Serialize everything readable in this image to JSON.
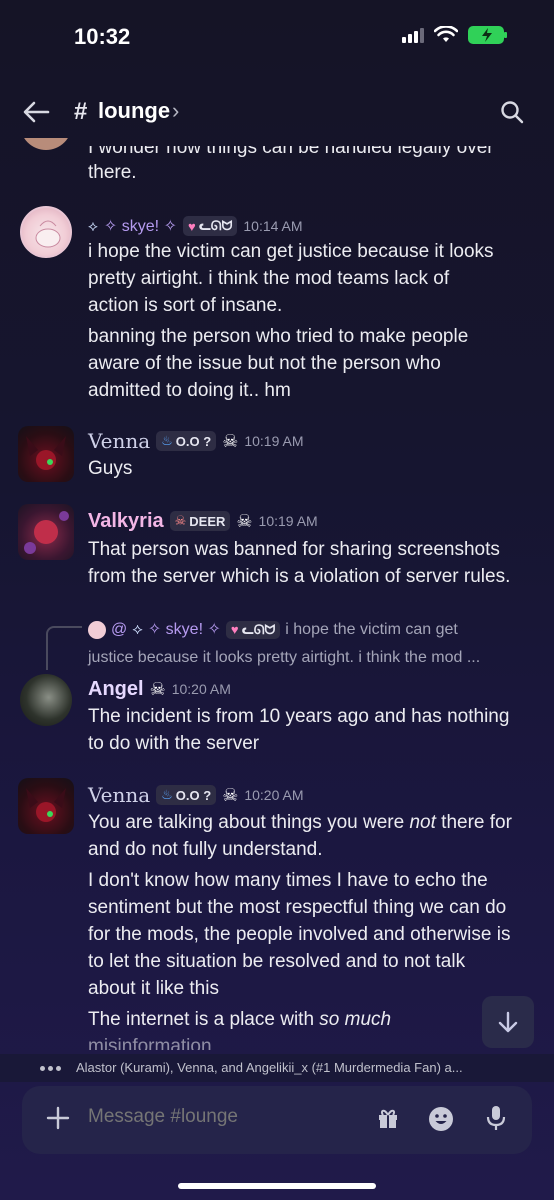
{
  "status": {
    "time": "10:32"
  },
  "header": {
    "hash": "#",
    "channel": "lounge",
    "chevron": "›"
  },
  "messages": {
    "partial_top": {
      "clipped": "I wonder how things can be handled legally over",
      "line2": "there."
    },
    "skye": {
      "name": "✧ skye! ✧",
      "tag": "ᓚᘏᗢ",
      "time": "10:14 AM",
      "lines": [
        "i hope the victim can get justice because it looks",
        "pretty airtight. i think the mod teams lack of",
        "action is sort of insane.",
        "banning the person who tried to make people",
        "aware of the issue but not the person who",
        "admitted to doing it.. hm"
      ]
    },
    "venna1": {
      "name": "Venna",
      "tag": "O.O ?",
      "time": "10:19 AM",
      "lines": [
        "Guys"
      ]
    },
    "valkyria": {
      "name": "Valkyria",
      "tag": "DEER",
      "time": "10:19 AM",
      "lines": [
        "That person was banned for sharing screenshots",
        "from the server which is a violation of server rules."
      ]
    },
    "reply": {
      "prefix": "@",
      "name": "✧ skye! ✧",
      "tag": "ᓚᘏᗢ",
      "line1": "i hope the victim can get",
      "line2": "justice because it looks pretty airtight. i think the mod ..."
    },
    "angel": {
      "name": "Angel",
      "time": "10:20 AM",
      "lines": [
        "The incident is from 10 years ago and has nothing",
        "to do with the server"
      ]
    },
    "venna2": {
      "name": "Venna",
      "tag": "O.O ?",
      "time": "10:20 AM",
      "line1_before": "You are talking about things you were ",
      "line1_em": "not",
      "line1_after": " there for",
      "lines": [
        "and do not fully understand.",
        "I don't know how many times I have to echo the",
        "sentiment but the most respectful thing we can do",
        "for the mods, the people involved and otherwise is",
        "to let the situation be resolved and to not talk",
        "about it like this"
      ],
      "last_before": "The internet is a place with ",
      "last_em": "so much",
      "last_line2": "misinformation"
    }
  },
  "typing": {
    "text": "Alastor (Kurami), Venna, and Angelikii_x (#1 Murdermedia Fan) a..."
  },
  "composer": {
    "placeholder": "Message #lounge"
  },
  "colors": {
    "accent": "#5865f2",
    "valkyria": "#f3b6e6",
    "skye": "#b69bf0",
    "angel": "#ffffff",
    "venna": "#cfd1e8"
  },
  "icons": {
    "back": "arrow-left-icon",
    "search": "search-icon",
    "plus": "plus-icon",
    "gift": "gift-icon",
    "emoji": "emoji-icon",
    "mic": "mic-icon",
    "scroll": "arrow-down-icon"
  }
}
